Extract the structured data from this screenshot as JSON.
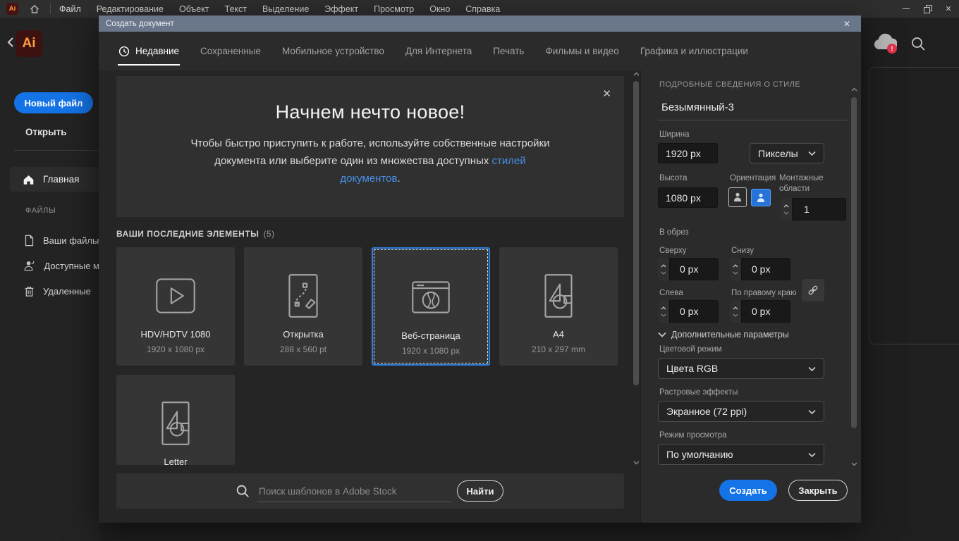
{
  "colors": {
    "accent_blue": "#1473e6",
    "link_blue": "#4790e8",
    "selection_blue": "#2f80de",
    "titlebar": "#6a7689"
  },
  "icons": {
    "close": "✕",
    "minimize": "–"
  },
  "menu_bar": {
    "items": [
      "Файл",
      "Редактирование",
      "Объект",
      "Текст",
      "Выделение",
      "Эффект",
      "Просмотр",
      "Окно",
      "Справка"
    ]
  },
  "app": {
    "logo_text": "Ai"
  },
  "sidebar": {
    "new_file": "Новый файл",
    "open": "Открыть",
    "home": "Главная",
    "files_header": "ФАЙЛЫ",
    "items": [
      {
        "label": "Ваши файлы"
      },
      {
        "label": "Доступные м"
      },
      {
        "label": "Удаленные"
      }
    ]
  },
  "dialog": {
    "title": "Создать документ",
    "tabs": [
      {
        "label": "Недавние",
        "active": true
      },
      {
        "label": "Сохраненные"
      },
      {
        "label": "Мобильное устройство"
      },
      {
        "label": "Для Интернета"
      },
      {
        "label": "Печать"
      },
      {
        "label": "Фильмы и видео"
      },
      {
        "label": "Графика и иллюстрации"
      }
    ],
    "banner": {
      "heading": "Начнем нечто новое!",
      "line1": "Чтобы быстро приступить к работе, используйте собственные настройки",
      "line2": "документа или выберите один из множества доступных",
      "link_line2": "стилей",
      "link_line3": "документов",
      "period": "."
    },
    "recent": {
      "header": "ВАШИ ПОСЛЕДНИЕ ЭЛЕМЕНТЫ",
      "count": "(5)",
      "cards": [
        {
          "title": "HDV/HDTV 1080",
          "dims": "1920 x 1080 px",
          "icon": "video",
          "selected": false
        },
        {
          "title": "Открытка",
          "dims": "288 x 560 pt",
          "icon": "postcard",
          "selected": false
        },
        {
          "title": "Веб-страница",
          "dims": "1920 x 1080 px",
          "icon": "web-globe",
          "selected": true
        },
        {
          "title": "A4",
          "dims": "210 x 297 mm",
          "icon": "shapes",
          "selected": false
        },
        {
          "title": "Letter",
          "dims": "",
          "icon": "shapes",
          "selected": false
        }
      ]
    },
    "search": {
      "placeholder": "Поиск шаблонов в Adobe Stock",
      "button": "Найти"
    },
    "panel": {
      "header": "ПОДРОБНЫЕ СВЕДЕНИЯ О СТИЛЕ",
      "doc_name": "Безымянный-3",
      "width_label": "Ширина",
      "width_value": "1920 px",
      "units_value": "Пикселы",
      "height_label": "Высота",
      "height_value": "1080 px",
      "orientation_label": "Ориентация",
      "artboards_label_line1": "Монтажные",
      "artboards_label_line2": "области",
      "artboards_value": "1",
      "bleed_label": "В обрез",
      "bleed_top_label": "Сверху",
      "bleed_top_value": "0 px",
      "bleed_bottom_label": "Снизу",
      "bleed_bottom_value": "0 px",
      "bleed_left_label": "Слева",
      "bleed_left_value": "0 px",
      "bleed_right_label": "По правому краю",
      "bleed_right_value": "0 px",
      "advanced_label": "Дополнительные параметры",
      "color_mode_label": "Цветовой режим",
      "color_mode_value": "Цвета RGB",
      "raster_label": "Растровые эффекты",
      "raster_value": "Экранное (72 ppi)",
      "preview_label": "Режим просмотра",
      "preview_value": "По умолчанию"
    },
    "actions": {
      "create": "Создать",
      "close": "Закрыть"
    }
  }
}
